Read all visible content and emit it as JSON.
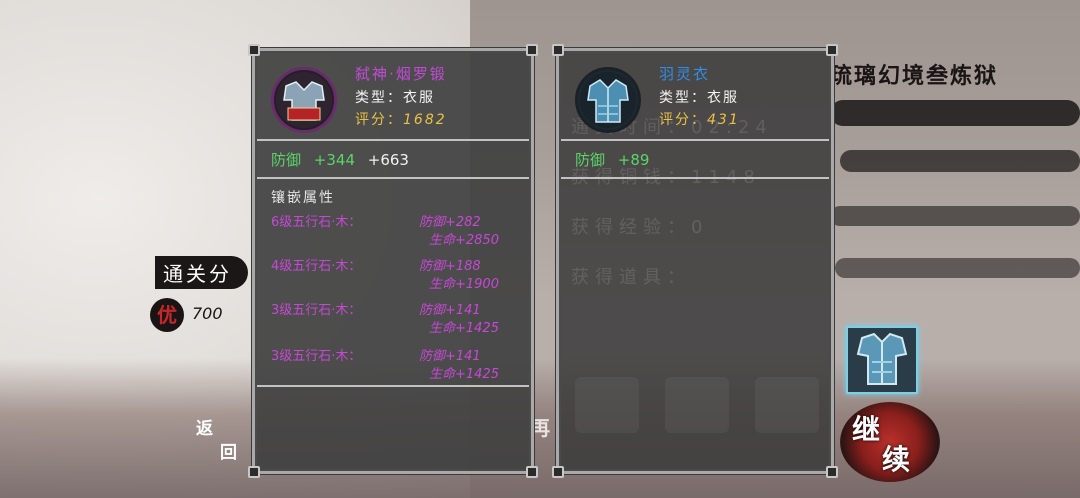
{
  "background": {
    "result_title": "琉璃幻境叁炼狱",
    "score_label": "通关分",
    "grade": "优",
    "grade_value": "700",
    "back_label_1": "返",
    "back_label_2": "回",
    "retry_char": "再",
    "continue_label_1": "继",
    "continue_label_2": "续"
  },
  "left_panel": {
    "name": "弑神·烟罗锻",
    "name_color": "#c04bd6",
    "type_label": "类型：",
    "type_value": "衣服",
    "score_label": "评分：",
    "score_value": "1682",
    "defense_label": "防御",
    "defense_value": "+344",
    "defense_extra": "+663",
    "socket_title": "镶嵌属性",
    "sockets": [
      {
        "stone": "6级五行石·木：",
        "line1": "防御+282",
        "line2": "生命+2850"
      },
      {
        "stone": "4级五行石·木：",
        "line1": "防御+188",
        "line2": "生命+1900"
      },
      {
        "stone": "3级五行石·木：",
        "line1": "防御+141",
        "line2": "生命+1425"
      },
      {
        "stone": "3级五行石·木：",
        "line1": "防御+141",
        "line2": "生命+1425"
      }
    ]
  },
  "right_panel": {
    "name": "羽灵衣",
    "name_color": "#2f8ee8",
    "type_label": "类型：",
    "type_value": "衣服",
    "score_label": "评分：",
    "score_value": "431",
    "defense_label": "防御",
    "defense_value": "+89"
  },
  "ghost_text": {
    "time": "通关时间：02:24",
    "coins": "获得铜钱：1148",
    "exp": "获得经验：0",
    "items": "获得道具："
  }
}
